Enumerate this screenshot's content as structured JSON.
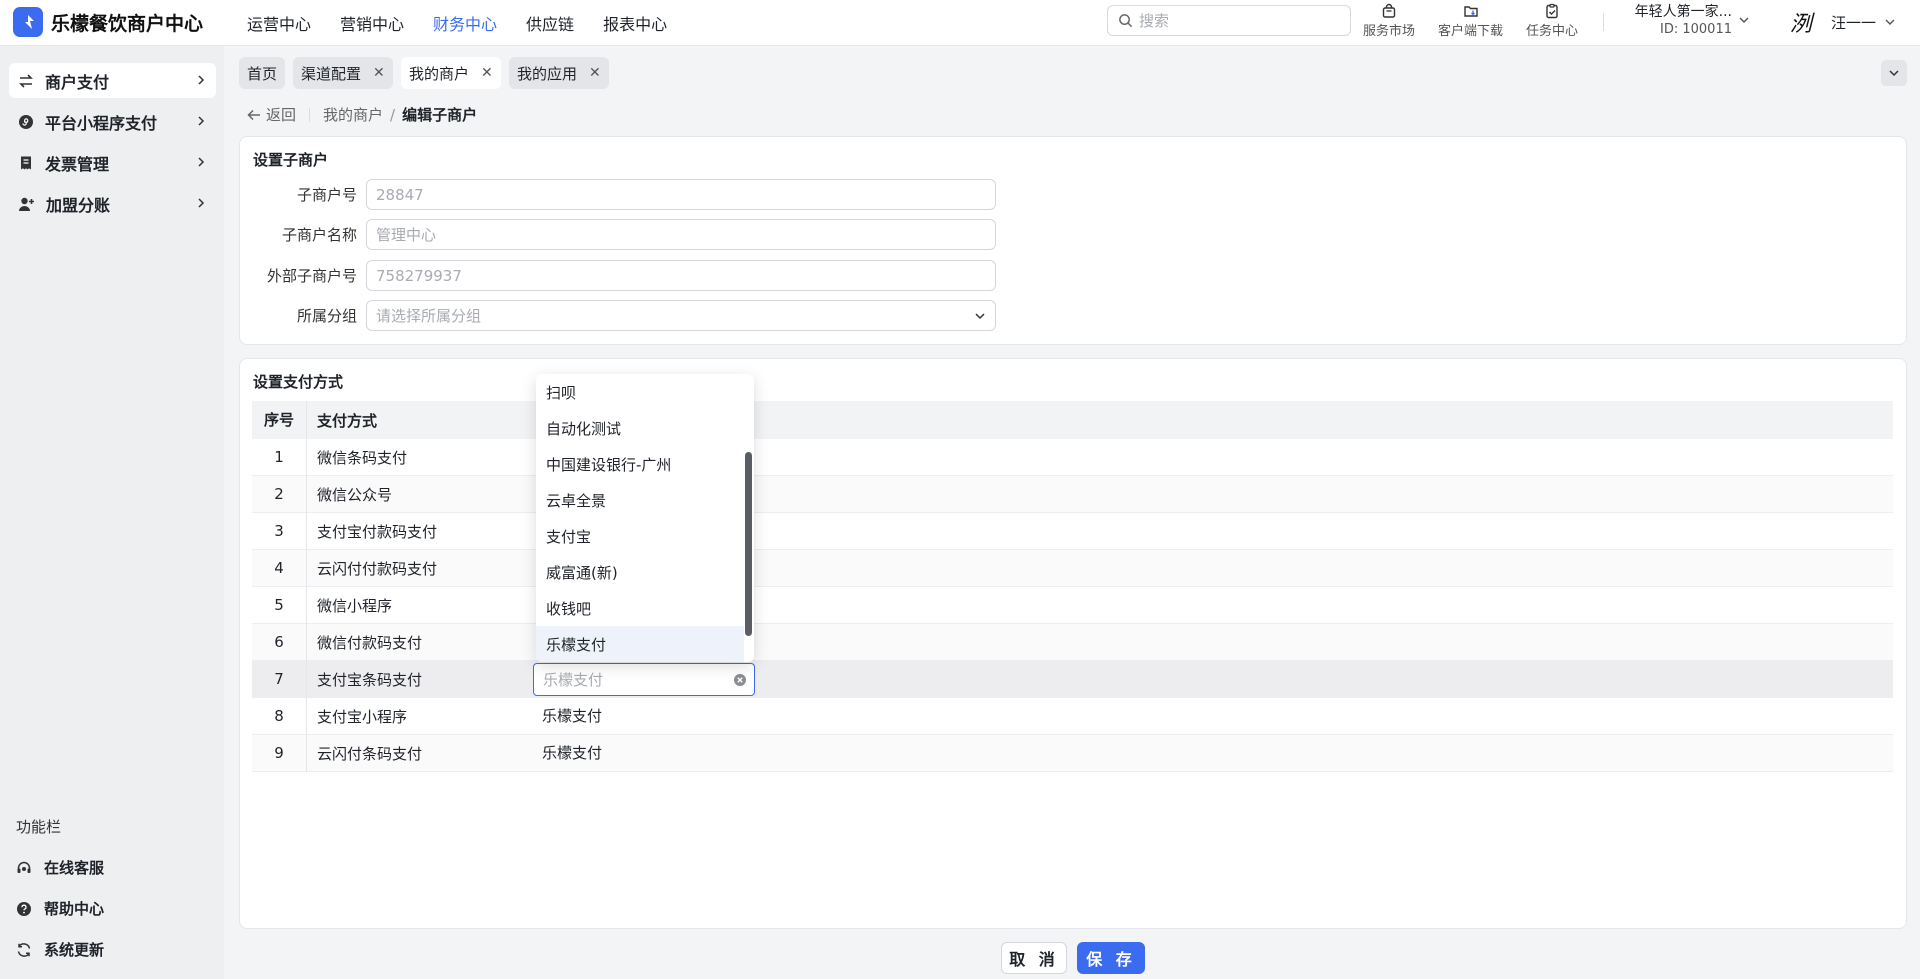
{
  "app": {
    "title": "乐檬餐饮商户中心",
    "brand_color": "#3b6cf0"
  },
  "topnav": [
    {
      "label": "运营中心"
    },
    {
      "label": "营销中心"
    },
    {
      "label": "财务中心",
      "active": true
    },
    {
      "label": "供应链"
    },
    {
      "label": "报表中心"
    }
  ],
  "search": {
    "placeholder": "搜索"
  },
  "tools": {
    "market": "服务市场",
    "download": "客户端下载",
    "tasks": "任务中心"
  },
  "org": {
    "name": "年轻人第一家...",
    "id": "ID: 100011"
  },
  "user": {
    "avatar_glyph": "洌",
    "name": "汪一一"
  },
  "sidebar": {
    "items": [
      {
        "label": "商户支付",
        "icon": "exchange-icon",
        "active": true
      },
      {
        "label": "平台小程序支付",
        "icon": "mini-program-icon"
      },
      {
        "label": "发票管理",
        "icon": "receipt-icon"
      },
      {
        "label": "加盟分账",
        "icon": "user-add-icon"
      }
    ],
    "func_title": "功能栏",
    "func_items": [
      {
        "label": "在线客服",
        "icon": "headset-icon"
      },
      {
        "label": "帮助中心",
        "icon": "help-icon"
      },
      {
        "label": "系统更新",
        "icon": "refresh-icon"
      }
    ]
  },
  "tabs": [
    {
      "label": "首页",
      "closable": false
    },
    {
      "label": "渠道配置",
      "closable": true
    },
    {
      "label": "我的商户",
      "closable": true,
      "active": true
    },
    {
      "label": "我的应用",
      "closable": true
    }
  ],
  "breadcrumb": {
    "back": "返回",
    "parent": "我的商户",
    "separator": "/",
    "current": "编辑子商户"
  },
  "submerchant": {
    "title": "设置子商户",
    "fields": {
      "id": {
        "label": "子商户号",
        "placeholder": "28847"
      },
      "name": {
        "label": "子商户名称",
        "placeholder": "管理中心"
      },
      "external_id": {
        "label": "外部子商户号",
        "placeholder": "758279937"
      },
      "group": {
        "label": "所属分组",
        "placeholder": "请选择所属分组"
      }
    }
  },
  "payment": {
    "title": "设置支付方式",
    "columns": {
      "no": "序号",
      "method": "支付方式"
    },
    "rows": [
      {
        "no": "1",
        "method": "微信条码支付",
        "channel": ""
      },
      {
        "no": "2",
        "method": "微信公众号",
        "channel": ""
      },
      {
        "no": "3",
        "method": "支付宝付款码支付",
        "channel": ""
      },
      {
        "no": "4",
        "method": "云闪付付款码支付",
        "channel": ""
      },
      {
        "no": "5",
        "method": "微信小程序",
        "channel": ""
      },
      {
        "no": "6",
        "method": "微信付款码支付",
        "channel": ""
      },
      {
        "no": "7",
        "method": "支付宝条码支付",
        "channel": "",
        "placeholder": "乐檬支付"
      },
      {
        "no": "8",
        "method": "支付宝小程序",
        "channel": "乐檬支付"
      },
      {
        "no": "9",
        "method": "云闪付条码支付",
        "channel": "乐檬支付"
      }
    ],
    "dropdown_options": [
      "扫呗",
      "自动化测试",
      "中国建设银行-广州",
      "云卓全景",
      "支付宝",
      "威富通(新)",
      "收钱吧",
      "乐檬支付"
    ],
    "dropdown_selected": "乐檬支付"
  },
  "footer": {
    "cancel": "取 消",
    "save": "保 存"
  }
}
